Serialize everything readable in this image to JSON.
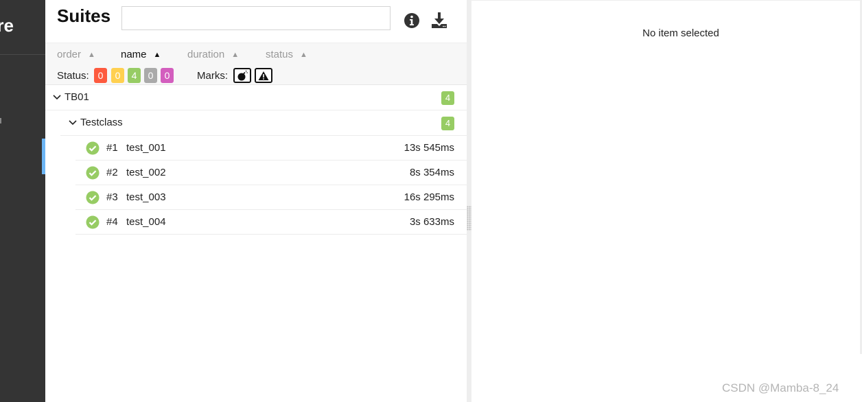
{
  "sidebar": {
    "brand_partial": "re"
  },
  "header": {
    "title": "Suites",
    "search_placeholder": ""
  },
  "sort": {
    "order": "order",
    "name": "name",
    "duration": "duration",
    "status": "status",
    "active": "name"
  },
  "status_filter": {
    "label": "Status:",
    "failed": "0",
    "broken": "0",
    "passed": "4",
    "skipped": "0",
    "unknown": "0"
  },
  "marks": {
    "label": "Marks:"
  },
  "tree": {
    "group": {
      "name": "TB01",
      "count": "4"
    },
    "subgroup": {
      "name": "Testclass",
      "count": "4"
    },
    "tests": [
      {
        "num": "#1",
        "name": "test_001",
        "duration": "13s 545ms",
        "status": "passed"
      },
      {
        "num": "#2",
        "name": "test_002",
        "duration": "8s 354ms",
        "status": "passed"
      },
      {
        "num": "#3",
        "name": "test_003",
        "duration": "16s 295ms",
        "status": "passed"
      },
      {
        "num": "#4",
        "name": "test_004",
        "duration": "3s 633ms",
        "status": "passed"
      }
    ]
  },
  "detail": {
    "empty_message": "No item selected"
  },
  "watermark": "CSDN @Mamba-8_24",
  "colors": {
    "failed": "#fd5a3e",
    "broken": "#ffd050",
    "passed": "#97cc64",
    "skipped": "#aaaaaa",
    "unknown": "#d35ebe",
    "sidebar": "#343434",
    "accent": "#6cb5f4"
  }
}
